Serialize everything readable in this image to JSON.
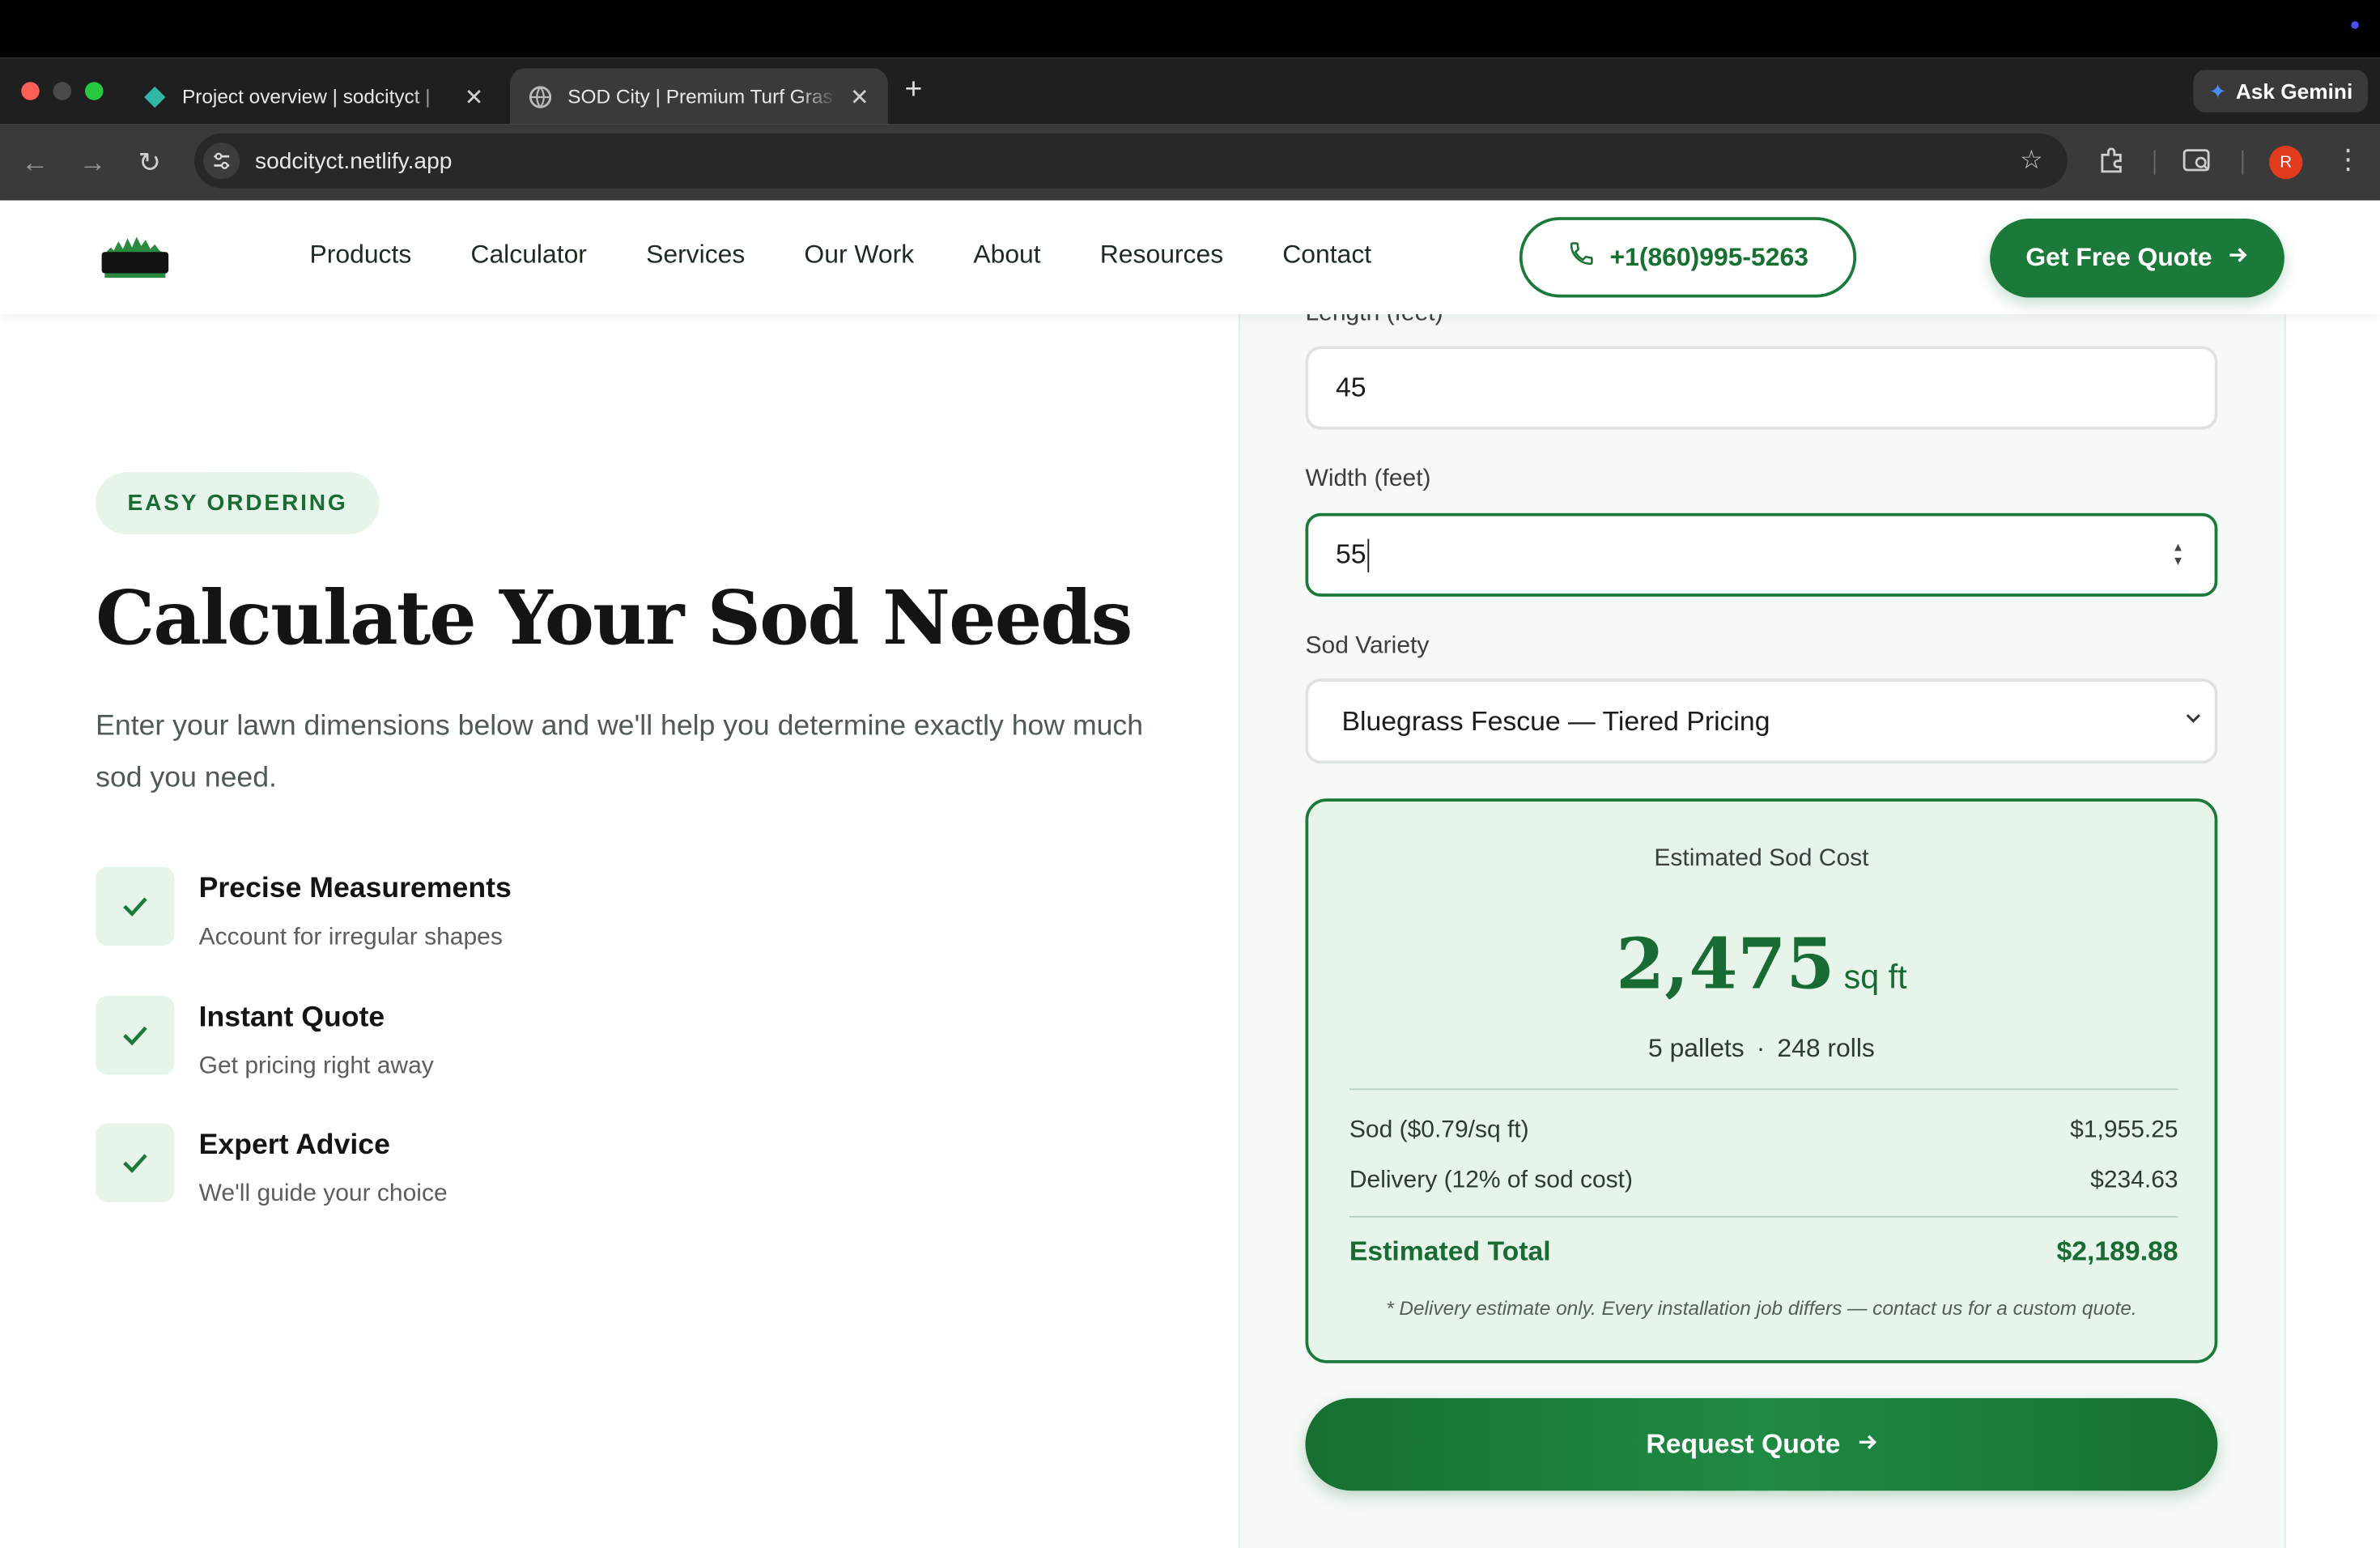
{
  "browser": {
    "tabs": [
      {
        "title": "Project overview | sodcityct |",
        "close": "✕"
      },
      {
        "title": "SOD City | Premium Turf Gras",
        "close": "✕"
      }
    ],
    "new_tab": "+",
    "ask_gemini": "Ask Gemini",
    "url": "sodcityct.netlify.app",
    "profile_initial": "R"
  },
  "site": {
    "logo_text": "SOD CITY",
    "nav": [
      "Products",
      "Calculator",
      "Services",
      "Our Work",
      "About",
      "Resources",
      "Contact"
    ],
    "phone": "+1(860)995-5263",
    "cta": "Get Free Quote"
  },
  "hero": {
    "badge": "EASY ORDERING",
    "title": "Calculate Your Sod Needs",
    "lead": "Enter your lawn dimensions below and we'll help you determine exactly how much sod you need.",
    "features": [
      {
        "title": "Precise Measurements",
        "desc": "Account for irregular shapes"
      },
      {
        "title": "Instant Quote",
        "desc": "Get pricing right away"
      },
      {
        "title": "Expert Advice",
        "desc": "We'll guide your choice"
      }
    ]
  },
  "calculator": {
    "length_label": "Length (feet)",
    "length_value": "45",
    "width_label": "Width (feet)",
    "width_value": "55",
    "variety_label": "Sod Variety",
    "variety_value": "Bluegrass Fescue — Tiered Pricing",
    "result": {
      "title": "Estimated Sod Cost",
      "area": "2,475",
      "area_unit": "sq ft",
      "pallets": "5 pallets",
      "separator": "·",
      "rolls": "248 rolls",
      "sod_label": "Sod ($0.79/sq ft)",
      "sod_value": "$1,955.25",
      "delivery_label": "Delivery (12% of sod cost)",
      "delivery_value": "$234.63",
      "total_label": "Estimated Total",
      "total_value": "$2,189.88",
      "note": "* Delivery estimate only. Every installation job differs — contact us for a custom quote."
    },
    "request_button": "Request Quote"
  },
  "colors": {
    "brand_green": "#1b7a3a",
    "light_green": "#e6f4ea"
  }
}
